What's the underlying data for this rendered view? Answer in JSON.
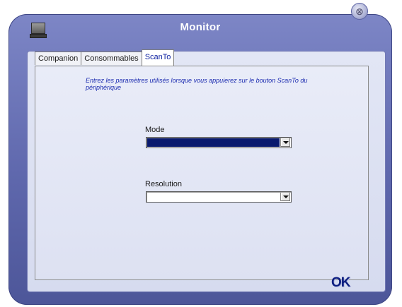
{
  "window": {
    "title": "Monitor",
    "close_glyph": "⊗"
  },
  "tabs": [
    {
      "label": "Companion"
    },
    {
      "label": "Consommables"
    },
    {
      "label": "ScanTo"
    }
  ],
  "active_tab": "ScanTo",
  "scanto": {
    "description": "Entrez les paramètres utilisés lorsque vous appuierez sur le bouton ScanTo du périphérique",
    "mode": {
      "label": "Mode",
      "value": ""
    },
    "resolution": {
      "label": "Resolution",
      "value": ""
    }
  },
  "ok_label": "OK",
  "icons": {
    "app": "computer-monitor-icon",
    "close": "close-icon",
    "dropdown": "chevron-down-icon"
  },
  "colors": {
    "frame": "#6a73b8",
    "panel": "#dfe3f4",
    "accent_text": "#1c2cb0",
    "ok_text": "#0d1e80"
  }
}
